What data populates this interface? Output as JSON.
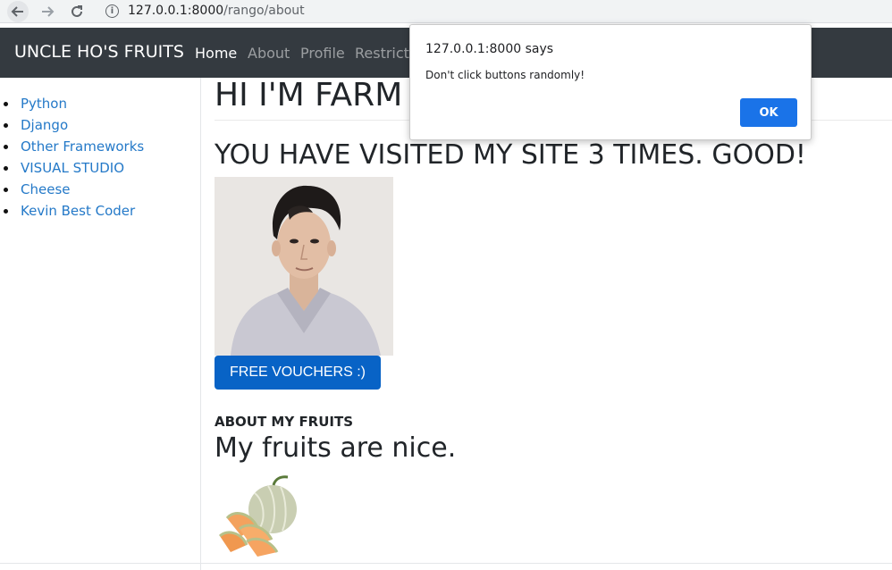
{
  "browser": {
    "url_host": "127.0.0.1:8000",
    "url_path": "/rango/about"
  },
  "navbar": {
    "brand": "UNCLE HO'S FRUITS",
    "links": [
      "Home",
      "About",
      "Profile",
      "Restricted"
    ]
  },
  "sidebar": {
    "items": [
      "Python",
      "Django",
      "Other Frameworks",
      "VISUAL STUDIO",
      "Cheese",
      "Kevin Best Coder"
    ]
  },
  "main": {
    "greeting": "HI I'M FARM",
    "visits": "YOU HAVE VISITED MY SITE 3 TIMES. GOOD!",
    "voucher_button": "FREE VOUCHERS :)",
    "about_heading": "ABOUT MY FRUITS",
    "about_text": "My fruits are nice."
  },
  "dialog": {
    "title": "127.0.0.1:8000 says",
    "message": "Don't click buttons randomly!",
    "ok_label": "OK"
  },
  "colors": {
    "navbar_bg": "#343a40",
    "link": "#2479c8",
    "voucher_bg": "#0863c6",
    "ok_bg": "#1a73e8"
  }
}
